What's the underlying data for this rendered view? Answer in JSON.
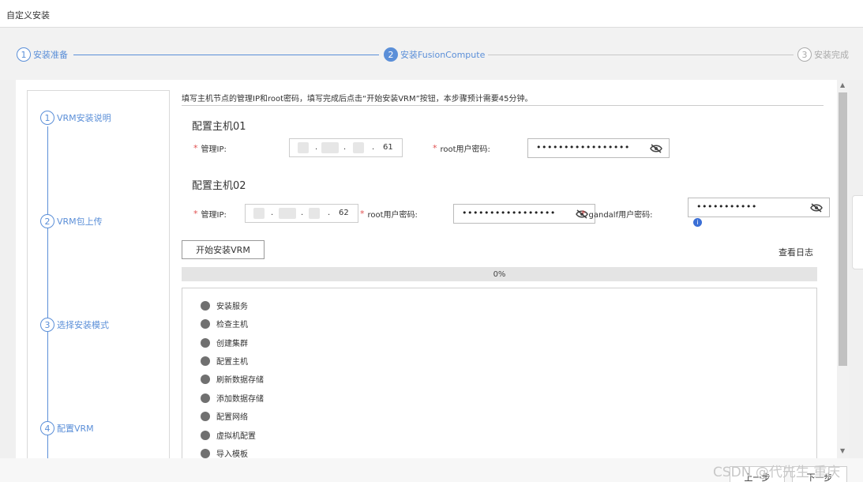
{
  "window": {
    "title": "自定义安装"
  },
  "stepper": {
    "steps": [
      {
        "num": "1",
        "label": "安装准备"
      },
      {
        "num": "2",
        "label": "安装FusionCompute"
      },
      {
        "num": "3",
        "label": "安装完成"
      }
    ]
  },
  "substeps": [
    {
      "num": "1",
      "label": "VRM安装说明"
    },
    {
      "num": "2",
      "label": "VRM包上传"
    },
    {
      "num": "3",
      "label": "选择安装模式"
    },
    {
      "num": "4",
      "label": "配置VRM"
    }
  ],
  "instruction": "填写主机节点的管理IP和root密码，填写完成后点击“开始安装VRM”按钮，本步骤预计需要45分钟。",
  "required_mark": "*",
  "host1": {
    "title": "配置主机01",
    "mgmt_ip_label": "管理IP:",
    "ip_last_octet": "61",
    "root_pw_label": "root用户密码:",
    "root_pw_value": "•••••••••••••••••"
  },
  "host2": {
    "title": "配置主机02",
    "mgmt_ip_label": "管理IP:",
    "ip_last_octet": "62",
    "root_pw_label": "root用户密码:",
    "root_pw_value": "•••••••••••••••••",
    "gandalf_pw_label": "gandalf用户密码:",
    "gandalf_pw_value": "•••••••••••"
  },
  "ip_separator": ".",
  "start_button": "开始安装VRM",
  "view_log": "查看日志",
  "progress": {
    "value": 0,
    "text": "0%"
  },
  "tasks": [
    "安装服务",
    "检查主机",
    "创建集群",
    "配置主机",
    "刷新数据存储",
    "添加数据存储",
    "配置网络",
    "虚拟机配置",
    "导入模板"
  ],
  "footer": {
    "prev": "上一步",
    "next": "下一步"
  },
  "watermark": "CSDN @代先生.重庆",
  "colors": {
    "accent": "#5b8fd8",
    "required": "#e05050",
    "task_dot": "#707070"
  },
  "icons": {
    "password_toggle": "eye-slash-icon",
    "info": "info-icon"
  }
}
